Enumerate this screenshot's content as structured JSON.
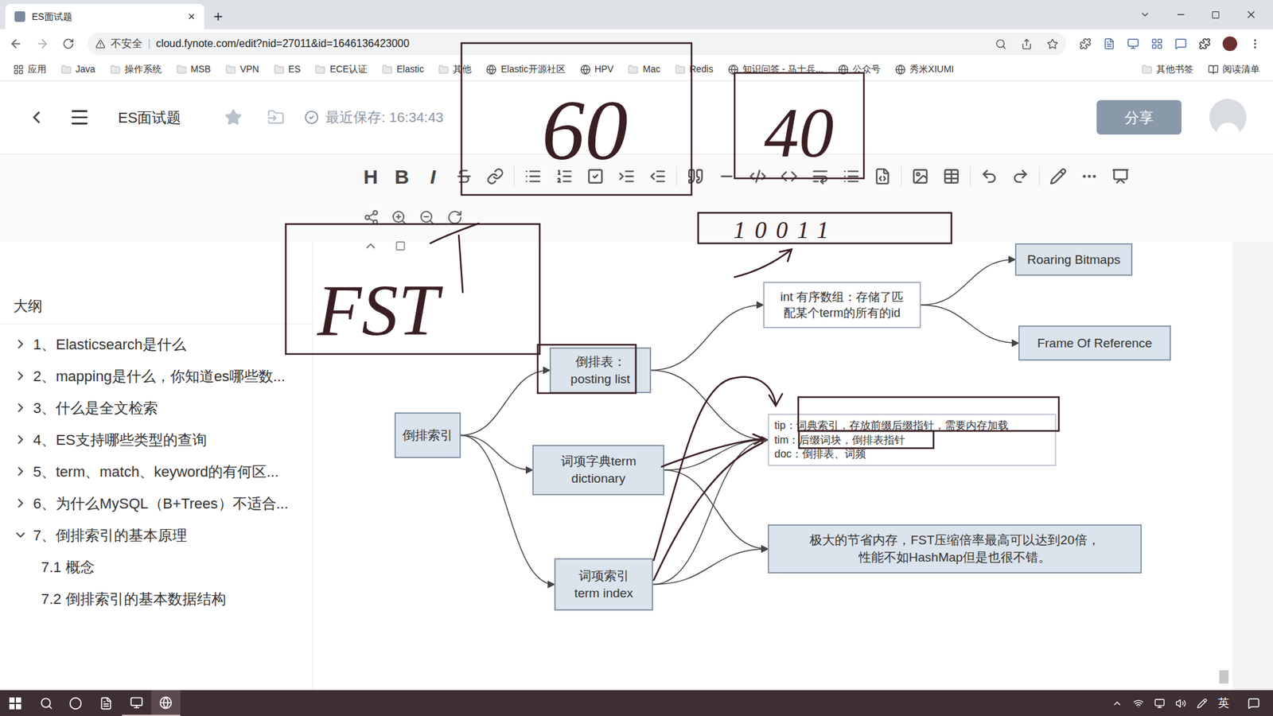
{
  "browser": {
    "tab": {
      "title": "ES面试题",
      "close": "×",
      "selected": true
    },
    "new_tab": "+",
    "security": "不安全",
    "url": "cloud.fynote.com/edit?nid=27011&id=1646136423000",
    "bookmarks": [
      {
        "label": "应用",
        "kind": "apps"
      },
      {
        "label": "Java",
        "kind": "folder"
      },
      {
        "label": "操作系统",
        "kind": "folder"
      },
      {
        "label": "MSB",
        "kind": "folder"
      },
      {
        "label": "VPN",
        "kind": "folder"
      },
      {
        "label": "ES",
        "kind": "folder"
      },
      {
        "label": "ECE认证",
        "kind": "folder"
      },
      {
        "label": "Elastic",
        "kind": "folder"
      },
      {
        "label": "其他",
        "kind": "folder"
      },
      {
        "label": "Elastic开源社区",
        "kind": "site"
      },
      {
        "label": "HPV",
        "kind": "site"
      },
      {
        "label": "Mac",
        "kind": "folder"
      },
      {
        "label": "Redis",
        "kind": "folder"
      },
      {
        "label": "知识问答 - 马士兵...",
        "kind": "site"
      },
      {
        "label": "公众号",
        "kind": "site"
      },
      {
        "label": "秀米XIUMI",
        "kind": "site"
      }
    ],
    "bookmarks_right": [
      {
        "label": "其他书签",
        "kind": "folder"
      },
      {
        "label": "阅读清单",
        "kind": "list"
      }
    ]
  },
  "header": {
    "title": "ES面试题",
    "saved": "最近保存: 16:34:43",
    "share": "分享"
  },
  "toolbar": {
    "letters": [
      "H",
      "B",
      "I"
    ]
  },
  "sidebar": {
    "heading": "大纲",
    "items": [
      {
        "label": "1、Elasticsearch是什么",
        "level": 1,
        "expanded": false
      },
      {
        "label": "2、mapping是什么，你知道es哪些数...",
        "level": 1,
        "expanded": false
      },
      {
        "label": "3、什么是全文检索",
        "level": 1,
        "expanded": false
      },
      {
        "label": "4、ES支持哪些类型的查询",
        "level": 1,
        "expanded": false
      },
      {
        "label": "5、term、match、keyword的有何区...",
        "level": 1,
        "expanded": false
      },
      {
        "label": "6、为什么MySQL（B+Trees）不适合...",
        "level": 1,
        "expanded": false
      },
      {
        "label": "7、倒排索引的基本原理",
        "level": 1,
        "expanded": true
      },
      {
        "label": "7.1 概念",
        "level": 2,
        "expanded": false
      },
      {
        "label": "7.2 倒排索引的基本数据结构",
        "level": 2,
        "expanded": false
      }
    ]
  },
  "mindmap": {
    "nodes": [
      {
        "kind": "topic",
        "lines": [
          "倒排索引"
        ]
      },
      {
        "kind": "topic",
        "lines": [
          "倒排表：",
          "posting list"
        ]
      },
      {
        "kind": "topic",
        "lines": [
          "词项字典term",
          "dictionary"
        ]
      },
      {
        "kind": "topic",
        "lines": [
          "词项索引",
          "term index"
        ]
      },
      {
        "kind": "note",
        "lines": [
          "int 有序数组：存储了匹",
          "配某个term的所有的id"
        ]
      },
      {
        "kind": "topic",
        "lines": [
          "Roaring Bitmaps"
        ]
      },
      {
        "kind": "topic",
        "lines": [
          "Frame Of Reference"
        ]
      },
      {
        "kind": "list",
        "lines": [
          "tip：词典索引，存放前缀后缀指针，需要内存加载",
          "tim：后缀词块，倒排表指针",
          "doc：倒排表、词频"
        ]
      },
      {
        "kind": "topic",
        "lines": [
          "极大的节省内存，FST压缩倍率最高可以达到20倍，",
          "性能不如HashMap但是也很不错。"
        ]
      }
    ]
  },
  "annotations": [
    "60",
    "40",
    "FST",
    "10011"
  ],
  "taskbar": {
    "ime": "英"
  }
}
